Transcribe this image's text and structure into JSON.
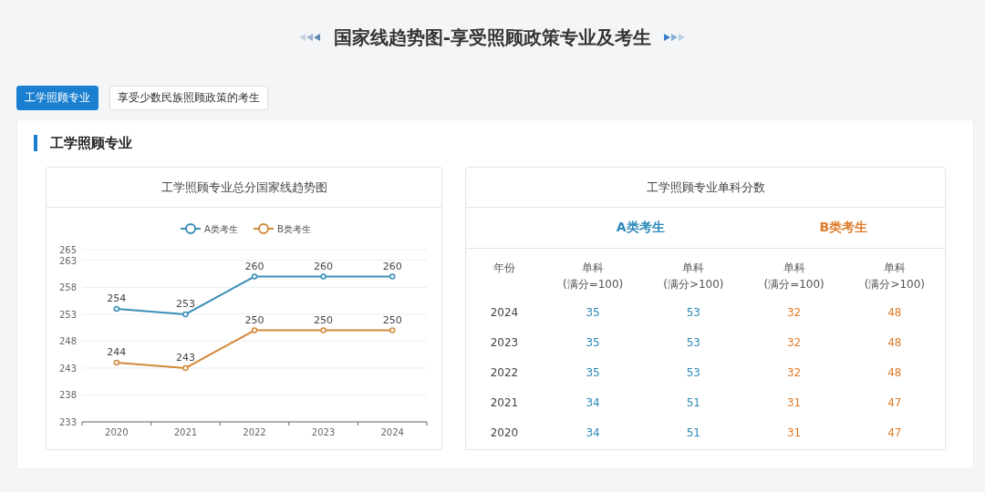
{
  "title": "国家线趋势图-享受照顾政策专业及考生",
  "tabs": [
    {
      "label": "工学照顾专业",
      "selected": true
    },
    {
      "label": "享受少数民族照顾政策的考生",
      "selected": false
    }
  ],
  "section": {
    "heading": "工学照顾专业",
    "trend_card": {
      "title": "工学照顾专业总分国家线趋势图",
      "chart_data": {
        "type": "line",
        "categories": [
          "2020",
          "2021",
          "2022",
          "2023",
          "2024"
        ],
        "series": [
          {
            "name": "A类考生",
            "color": "#3a8fb7",
            "marker": "circle",
            "values": [
              254,
              253,
              260,
              260,
              260
            ]
          },
          {
            "name": "B类考生",
            "color": "#d4883a",
            "marker": "circle",
            "values": [
              244,
              243,
              250,
              250,
              250
            ]
          }
        ],
        "grid": true,
        "legend": true,
        "ylim": [
          233,
          265
        ],
        "yticks": [
          233,
          238,
          243,
          248,
          253,
          258,
          263,
          265
        ],
        "data_labels": true
      }
    },
    "score_card": {
      "title": "工学照顾专业单科分数",
      "year_header": "年份",
      "groups": [
        {
          "label": "A类考生",
          "color": "#2a8ab8",
          "columns": [
            {
              "label": "单科",
              "note": "(满分=100)"
            },
            {
              "label": "单科",
              "note": "(满分>100)"
            }
          ]
        },
        {
          "label": "B类考生",
          "color": "#e07b28",
          "columns": [
            {
              "label": "单科",
              "note": "(满分=100)"
            },
            {
              "label": "单科",
              "note": "(满分>100)"
            }
          ]
        }
      ],
      "rows": [
        {
          "year": "2024",
          "values": [
            "35",
            "53",
            "32",
            "48"
          ]
        },
        {
          "year": "2023",
          "values": [
            "35",
            "53",
            "32",
            "48"
          ]
        },
        {
          "year": "2022",
          "values": [
            "35",
            "53",
            "32",
            "48"
          ]
        },
        {
          "year": "2021",
          "values": [
            "34",
            "51",
            "31",
            "47"
          ]
        },
        {
          "year": "2020",
          "values": [
            "34",
            "51",
            "31",
            "47"
          ]
        }
      ]
    }
  }
}
